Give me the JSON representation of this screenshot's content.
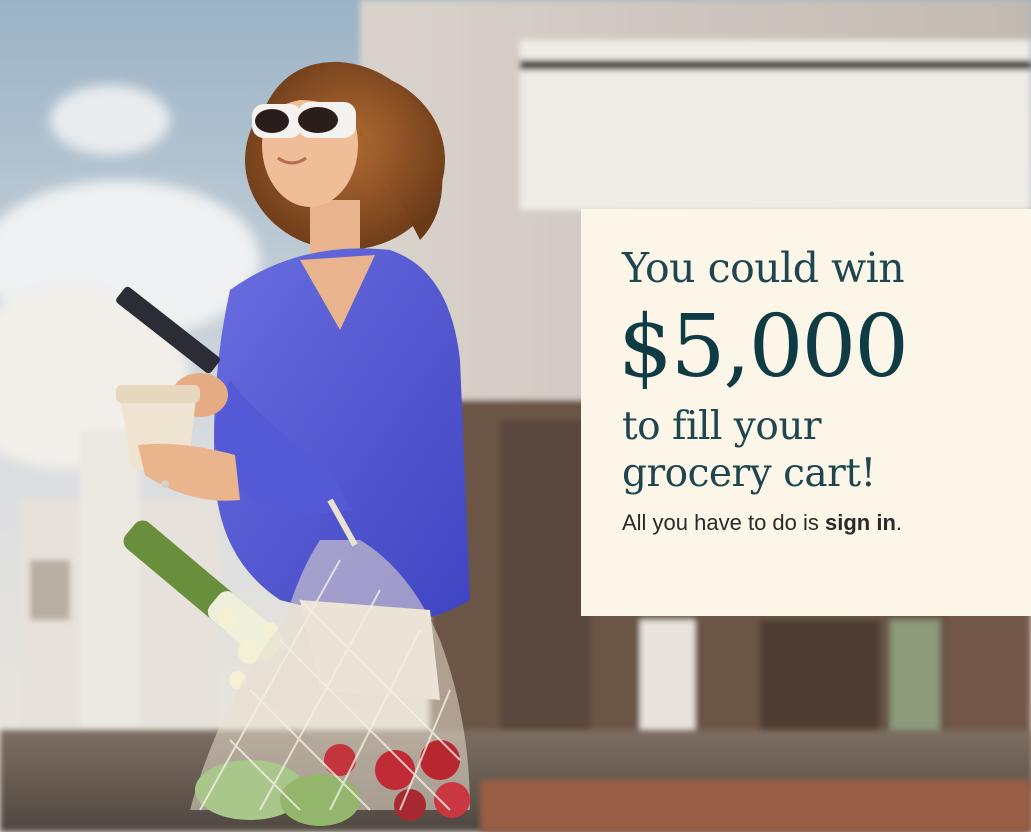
{
  "promo": {
    "line1": "You could win",
    "amount": "$5,000",
    "line2": "to fill your",
    "line3": "grocery cart!",
    "cta_before": "All you have to do is ",
    "cta_link": "sign in",
    "cta_after": "."
  },
  "colors": {
    "card_background": "#fcf6e8",
    "heading_text": "#1f4650",
    "amount_text": "#0f3b45",
    "body_text": "#2a2a2a"
  },
  "icons": {
    "hero": "woman-with-grocery-bag-photo"
  }
}
